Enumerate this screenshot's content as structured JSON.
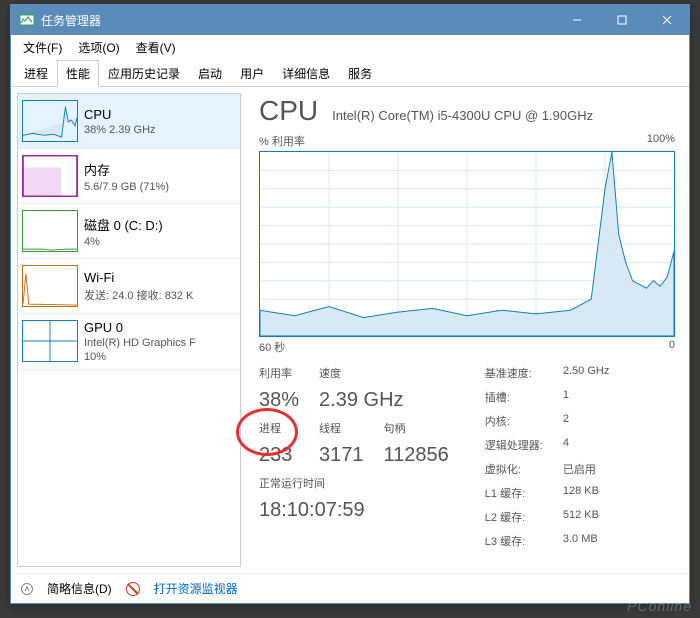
{
  "window": {
    "title": "任务管理器"
  },
  "menu": {
    "file": "文件(F)",
    "options": "选项(O)",
    "view": "查看(V)"
  },
  "tabs": {
    "processes": "进程",
    "performance": "性能",
    "app_history": "应用历史记录",
    "startup": "启动",
    "users": "用户",
    "details": "详细信息",
    "services": "服务"
  },
  "sidebar": {
    "items": [
      {
        "title": "CPU",
        "sub": "38%  2.39 GHz"
      },
      {
        "title": "内存",
        "sub": "5.6/7.9 GB (71%)"
      },
      {
        "title": "磁盘 0 (C: D:)",
        "sub": "4%"
      },
      {
        "title": "Wi-Fi",
        "sub": "发送: 24.0 接收: 832 K"
      },
      {
        "title": "GPU 0",
        "sub": "Intel(R) HD Graphics F",
        "sub2": "10%"
      }
    ]
  },
  "main": {
    "heading": "CPU",
    "cpu_name": "Intel(R) Core(TM) i5-4300U CPU @ 1.90GHz",
    "y_label": "% 利用率",
    "y_max": "100%",
    "x_left": "60 秒",
    "x_right": "0",
    "stats_left": {
      "util_lab": "利用率",
      "util": "38%",
      "speed_lab": "速度",
      "speed": "2.39 GHz",
      "proc_lab": "进程",
      "proc": "233",
      "thread_lab": "线程",
      "thread": "3171",
      "handle_lab": "句柄",
      "handle": "112856",
      "uptime_lab": "正常运行时间",
      "uptime": "18:10:07:59"
    },
    "stats_right": {
      "base_lab": "基准速度:",
      "base": "2.50 GHz",
      "sockets_lab": "插槽:",
      "sockets": "1",
      "cores_lab": "内核:",
      "cores": "2",
      "lproc_lab": "逻辑处理器:",
      "lproc": "4",
      "virt_lab": "虚拟化:",
      "virt": "已启用",
      "l1_lab": "L1 缓存:",
      "l1": "128 KB",
      "l2_lab": "L2 缓存:",
      "l2": "512 KB",
      "l3_lab": "L3 缓存:",
      "l3": "3.0 MB"
    }
  },
  "footer": {
    "fewer": "简略信息(D)",
    "resmon": "打开资源监视器"
  },
  "watermark": "PConline",
  "chart_data": {
    "type": "line",
    "title": "% 利用率",
    "xlabel": "秒 (60 → 0)",
    "ylabel": "% 利用率",
    "ylim": [
      0,
      100
    ],
    "x": [
      60,
      55,
      50,
      45,
      40,
      35,
      30,
      25,
      20,
      15,
      12,
      10,
      9,
      8,
      7,
      6,
      5,
      4,
      3,
      2,
      1,
      0
    ],
    "values": [
      14,
      11,
      16,
      10,
      13,
      15,
      11,
      14,
      12,
      14,
      20,
      80,
      100,
      55,
      40,
      30,
      28,
      26,
      30,
      27,
      32,
      46
    ]
  }
}
